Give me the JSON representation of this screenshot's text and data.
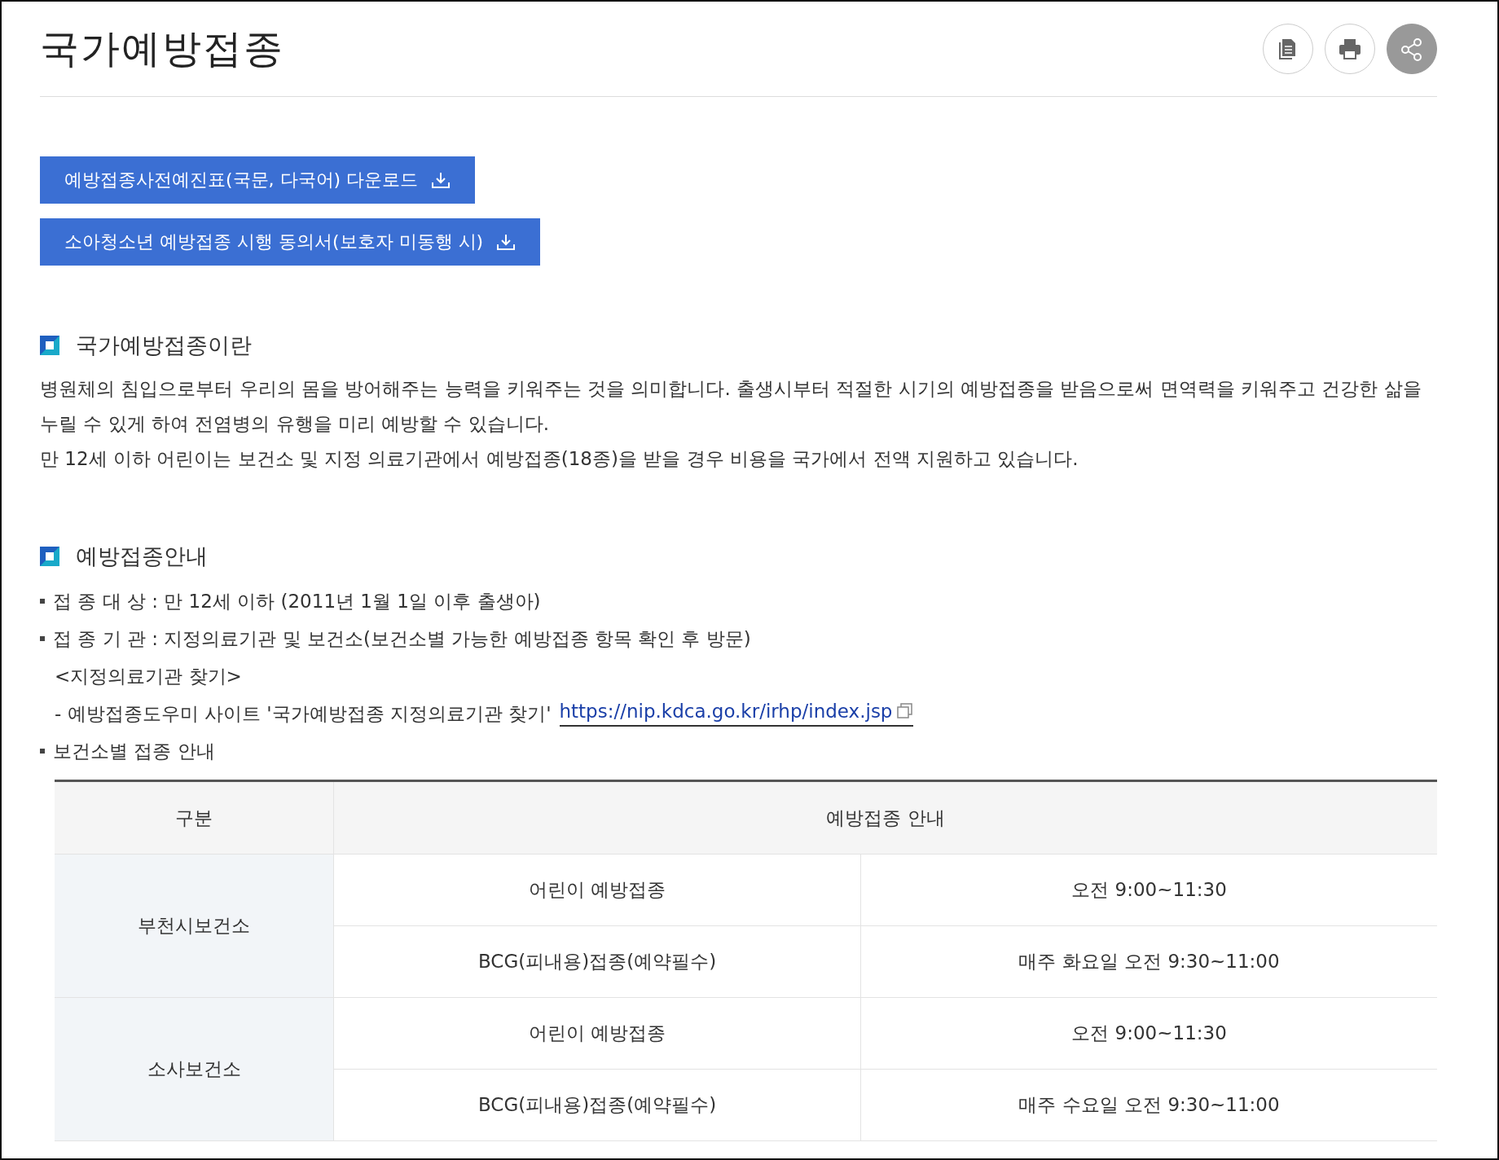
{
  "page_title": "국가예방접종",
  "tools": [
    {
      "kind": "document"
    },
    {
      "kind": "print"
    },
    {
      "kind": "share"
    }
  ],
  "download_buttons": [
    "예방접종사전예진표(국문, 다국어) 다운로드",
    "소아청소년 예방접종 시행 동의서(보호자 미동행 시)"
  ],
  "sections": [
    {
      "heading": "국가예방접종이란",
      "paragraphs": [
        "병원체의 침입으로부터 우리의 몸을 방어해주는 능력을 키워주는 것을 의미합니다. 출생시부터 적절한 시기의 예방접종을 받음으로써 면역력을 키워주고 건강한 삶을 누릴 수 있게 하여 전염병의 유행을 미리 예방할 수 있습니다.",
        "만 12세 이하 어린이는 보건소 및 지정 의료기관에서 예방접종(18종)을 받을 경우 비용을 국가에서 전액 지원하고 있습니다."
      ]
    },
    {
      "heading": "예방접종안내",
      "items": [
        {
          "kind": "bullet",
          "text": "접 종 대 상 : 만 12세 이하 (2011년 1월 1일 이후 출생아)"
        },
        {
          "kind": "bullet",
          "text": "접 종 기 관 : 지정의료기관 및 보건소(보건소별 가능한 예방접종 항목 확인 후 방문)"
        },
        {
          "kind": "sub",
          "text": "<지정의료기관 찾기>"
        },
        {
          "kind": "link",
          "text": "- 예방접종도우미 사이트 '국가예방접종 지정의료기관 찾기'",
          "link": "https://nip.kdca.go.kr/irhp/index.jsp"
        },
        {
          "kind": "bullet",
          "text": "보건소별 접종 안내"
        }
      ]
    }
  ],
  "table": {
    "columns": [
      "구분",
      "예방접종 안내"
    ],
    "groups": [
      {
        "name": "부천시보건소",
        "rows": [
          [
            "어린이 예방접종",
            "오전 9:00~11:30"
          ],
          [
            "BCG(피내용)접종(예약필수)",
            "매주 화요일 오전 9:30~11:00"
          ]
        ]
      },
      {
        "name": "소사보건소",
        "rows": [
          [
            "어린이 예방접종",
            "오전 9:00~11:30"
          ],
          [
            "BCG(피내용)접종(예약필수)",
            "매주 수요일 오전 9:30~11:00"
          ]
        ]
      }
    ]
  }
}
